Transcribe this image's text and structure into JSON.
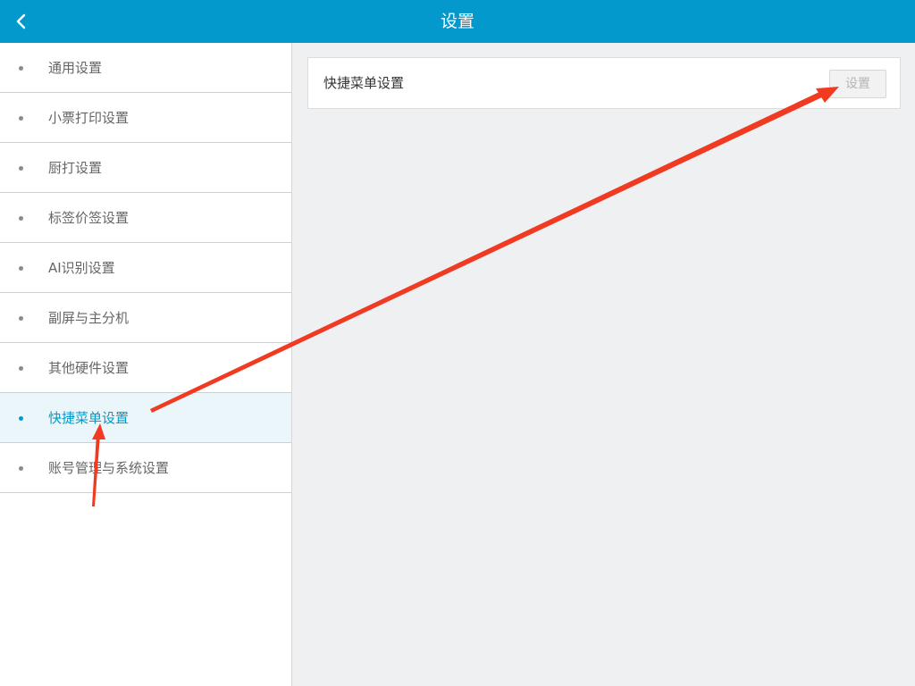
{
  "header": {
    "title": "设置",
    "back_icon": "chevron-left-icon",
    "background_color": "#0399cc"
  },
  "sidebar": {
    "items": [
      {
        "label": "通用设置"
      },
      {
        "label": "小票打印设置"
      },
      {
        "label": "厨打设置"
      },
      {
        "label": "标签价签设置"
      },
      {
        "label": "AI识别设置"
      },
      {
        "label": "副屏与主分机"
      },
      {
        "label": "其他硬件设置"
      },
      {
        "label": "快捷菜单设置",
        "active": true
      },
      {
        "label": "账号管理与系统设置"
      }
    ],
    "active_color": "#0399cc"
  },
  "content": {
    "card": {
      "title": "快捷菜单设置",
      "button_label": "设置"
    }
  },
  "annotations": {
    "arrow_color": "#f03a22"
  }
}
